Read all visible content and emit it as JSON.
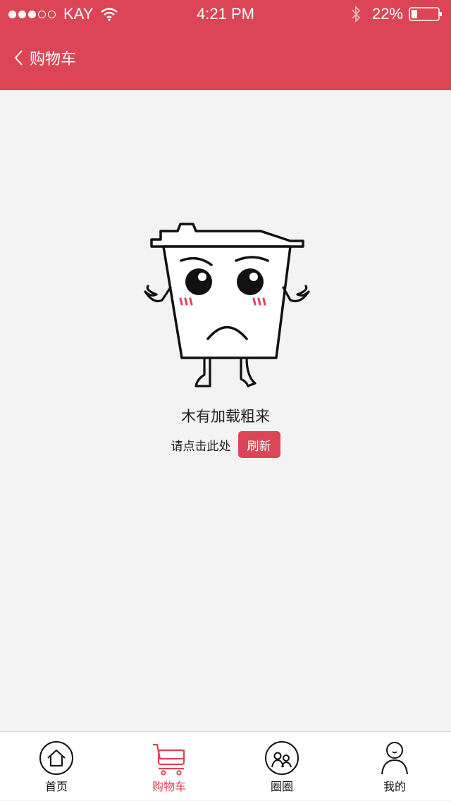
{
  "status_bar": {
    "carrier": "KAY",
    "time": "4:21 PM",
    "battery": "22%",
    "icons": [
      "signal-dots",
      "wifi-icon",
      "bluetooth-icon",
      "battery-icon"
    ]
  },
  "nav": {
    "title": "购物车",
    "back_icon": "chevron-left-icon"
  },
  "empty_state": {
    "title": "木有加载粗来",
    "hint": "请点击此处",
    "refresh_label": "刷新",
    "illustration": "sad-trash-can-mascot"
  },
  "tabs": [
    {
      "label": "首页",
      "icon": "home-icon",
      "active": false
    },
    {
      "label": "购物车",
      "icon": "cart-icon",
      "active": true
    },
    {
      "label": "圈圈",
      "icon": "circle-people-icon",
      "active": false
    },
    {
      "label": "我的",
      "icon": "user-icon",
      "active": false
    }
  ],
  "colors": {
    "accent": "#dc4556",
    "background": "#f3f3f3",
    "tab_bar": "#ffffff"
  }
}
